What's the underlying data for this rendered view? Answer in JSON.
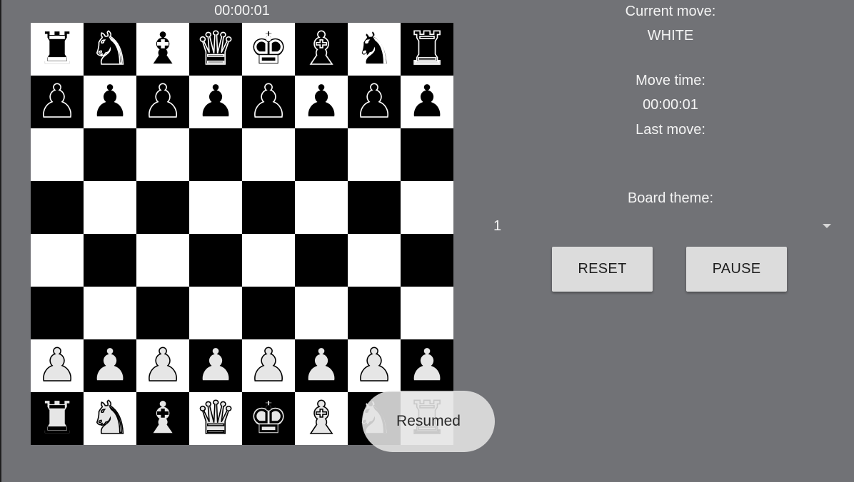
{
  "board_timer": "00:00:01",
  "side_panel": {
    "current_move_label": "Current move:",
    "current_move_value": "WHITE",
    "move_time_label": "Move time:",
    "move_time_value": "00:00:01",
    "last_move_label": "Last move:",
    "board_theme_label": "Board theme:",
    "board_theme_value": "1",
    "reset_label": "RESET",
    "pause_label": "PAUSE"
  },
  "toast": {
    "text": "Resumed"
  },
  "colors": {
    "background": "#717276",
    "light_square": "#ffffff",
    "dark_square": "#000000",
    "button": "#dcdcdc"
  },
  "board": {
    "rows": [
      [
        "black-rook",
        "black-knight",
        "black-bishop",
        "black-queen",
        "black-king",
        "black-bishop",
        "black-knight",
        "black-rook"
      ],
      [
        "black-pawn",
        "black-pawn",
        "black-pawn",
        "black-pawn",
        "black-pawn",
        "black-pawn",
        "black-pawn",
        "black-pawn"
      ],
      [
        "",
        "",
        "",
        "",
        "",
        "",
        "",
        ""
      ],
      [
        "",
        "",
        "",
        "",
        "",
        "",
        "",
        ""
      ],
      [
        "",
        "",
        "",
        "",
        "",
        "",
        "",
        ""
      ],
      [
        "",
        "",
        "",
        "",
        "",
        "",
        "",
        ""
      ],
      [
        "white-pawn",
        "white-pawn",
        "white-pawn",
        "white-pawn",
        "white-pawn",
        "white-pawn",
        "white-pawn",
        "white-pawn"
      ],
      [
        "white-rook",
        "white-knight",
        "white-bishop",
        "white-queen",
        "white-king",
        "white-bishop",
        "white-knight",
        "white-rook"
      ]
    ]
  }
}
